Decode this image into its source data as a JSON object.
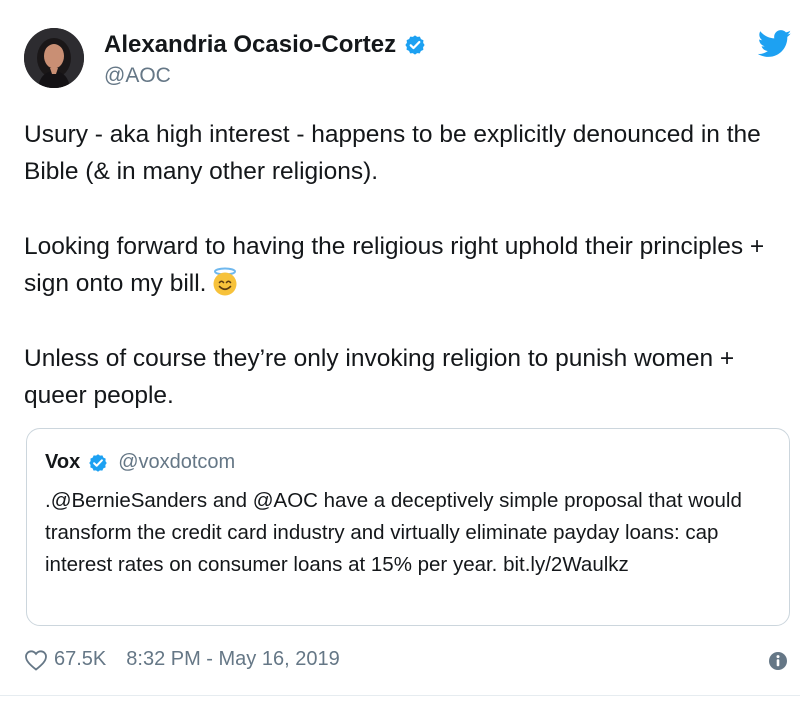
{
  "author": {
    "name": "Alexandria Ocasio-Cortez",
    "handle": "@AOC"
  },
  "tweet": {
    "paragraphs": [
      "Usury - aka high interest - happens to be explicitly denounced in the Bible (& in many other religions).",
      "Looking forward to having the religious right uphold their principles + sign onto my bill.",
      "Unless of course they’re only invoking religion to punish women + queer people."
    ],
    "emoji": "smiling-face-with-halo"
  },
  "quoted": {
    "name": "Vox",
    "handle": "@voxdotcom",
    "text": ".@BernieSanders and @AOC  have a deceptively simple proposal that would transform the credit card industry and virtually eliminate payday loans: cap interest rates on consumer loans at 15% per year. bit.ly/2Waulkz"
  },
  "footer": {
    "likes": "67.5K",
    "timestamp": "8:32 PM - May 16, 2019"
  },
  "icons": {
    "verified": "verified-badge-icon",
    "brand": "twitter-bird-icon",
    "like": "heart-icon",
    "info": "info-icon"
  },
  "colors": {
    "twitter_blue": "#1da1f2",
    "secondary_text": "#657786",
    "border": "#ccd6dd"
  }
}
